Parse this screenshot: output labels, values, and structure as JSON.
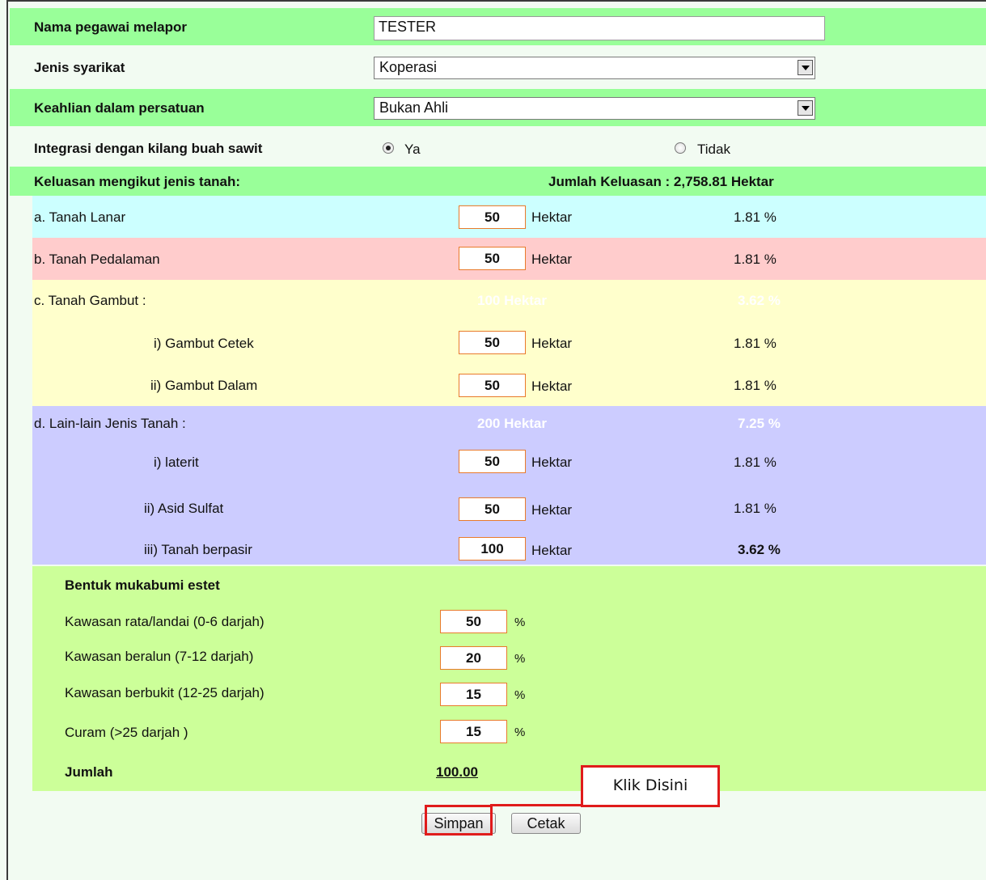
{
  "form": {
    "nama_label": "Nama pegawai melapor",
    "nama_value": "TESTER",
    "jenis_label": "Jenis syarikat",
    "jenis_value": "Koperasi",
    "keahlian_label": "Keahlian dalam persatuan",
    "keahlian_value": "Bukan Ahli",
    "integrasi_label": "Integrasi dengan kilang buah sawit",
    "radio_ya": "Ya",
    "radio_tidak": "Tidak",
    "integrasi_selected": "Ya"
  },
  "keluasan": {
    "heading": "Keluasan mengikut jenis tanah:",
    "jumlah": "Jumlah Keluasan : 2,758.81 Hektar",
    "unit": "Hektar",
    "lanar": {
      "label": "a. Tanah Lanar",
      "value": "50",
      "pct": "1.81 %"
    },
    "pedalaman": {
      "label": "b. Tanah Pedalaman",
      "value": "50",
      "pct": "1.81 %"
    },
    "gambut": {
      "label": "c. Tanah Gambut :",
      "total": "100 Hektar",
      "pct": "3.62 %",
      "cetek": {
        "label": "i) Gambut Cetek",
        "value": "50",
        "pct": "1.81 %"
      },
      "dalam": {
        "label": "ii) Gambut Dalam",
        "value": "50",
        "pct": "1.81 %"
      }
    },
    "lain": {
      "label": "d. Lain-lain Jenis Tanah :",
      "total": "200 Hektar",
      "pct": "7.25 %",
      "laterit": {
        "label": "i) laterit",
        "value": "50",
        "pct": "1.81 %"
      },
      "asid": {
        "label": "ii) Asid Sulfat",
        "value": "50",
        "pct": "1.81 %"
      },
      "pasir": {
        "label": "iii) Tanah berpasir",
        "value": "100",
        "pct": "3.62 %"
      }
    }
  },
  "mukabumi": {
    "heading": "Bentuk mukabumi estet",
    "unit": "%",
    "rata": {
      "label": "Kawasan rata/landai (0-6 darjah)",
      "value": "50"
    },
    "beralun": {
      "label": "Kawasan beralun (7-12 darjah)",
      "value": "20"
    },
    "berbukit": {
      "label": "Kawasan berbukit (12-25 darjah)",
      "value": "15"
    },
    "curam": {
      "label": "Curam (>25 darjah )",
      "value": "15"
    },
    "jumlah_label": "Jumlah",
    "jumlah_value": "100.00"
  },
  "buttons": {
    "simpan": "Simpan",
    "cetak": "Cetak"
  },
  "annotation": {
    "callout": "Klik Disini"
  },
  "colors": {
    "green": "#99ff99",
    "cyan": "#ccffff",
    "pink": "#ffcccc",
    "yellow": "#ffffcc",
    "lavender": "#ccccff",
    "lime": "#ccff99",
    "accent": "#e01b1b"
  }
}
